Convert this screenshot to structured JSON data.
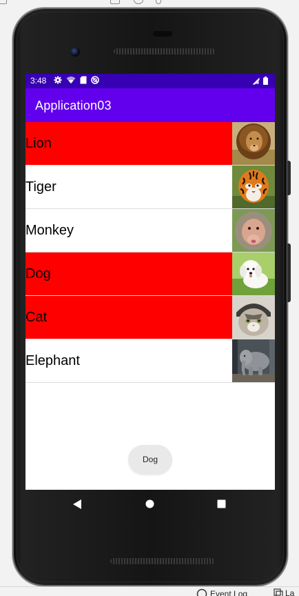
{
  "status_bar": {
    "time": "3:48",
    "icons": [
      "settings-gear-icon",
      "wifi-icon",
      "sd-card-icon",
      "do-not-disturb-icon"
    ],
    "right_icons": [
      "signal-icon",
      "battery-icon"
    ],
    "background": "#3700b3"
  },
  "app_bar": {
    "title": "Application03",
    "background": "#6200ee"
  },
  "list": {
    "items": [
      {
        "label": "Lion",
        "highlighted": true,
        "image": "lion-image"
      },
      {
        "label": "Tiger",
        "highlighted": false,
        "image": "tiger-image"
      },
      {
        "label": "Monkey",
        "highlighted": false,
        "image": "monkey-image"
      },
      {
        "label": "Dog",
        "highlighted": true,
        "image": "dog-image"
      },
      {
        "label": "Cat",
        "highlighted": true,
        "image": "cat-image"
      },
      {
        "label": "Elephant",
        "highlighted": false,
        "image": "elephant-image"
      }
    ],
    "highlight_color": "#ff0000"
  },
  "toast": {
    "text": "Dog"
  },
  "nav_bar": {
    "buttons": [
      "back-icon",
      "home-icon",
      "recents-icon"
    ]
  },
  "ide": {
    "event_log": "Event Log",
    "layout_inspector": "La"
  }
}
